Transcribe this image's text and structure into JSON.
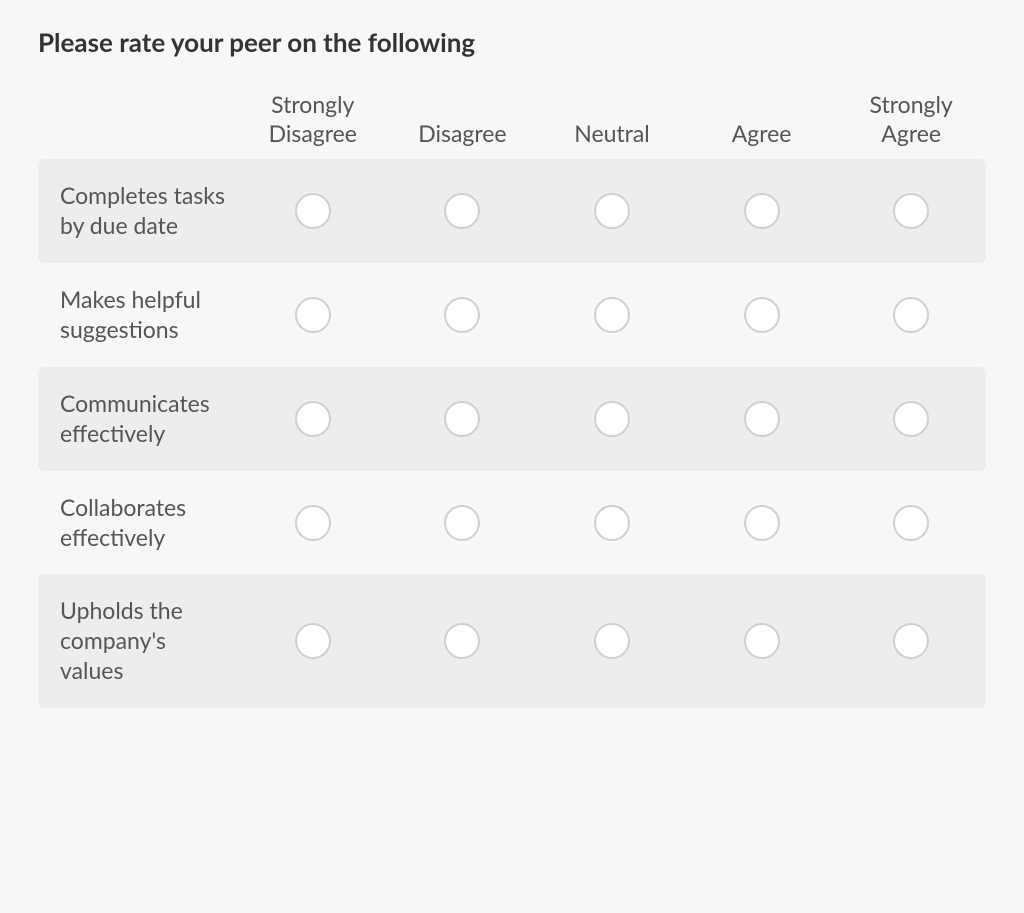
{
  "question_title": "Please rate your peer on the following",
  "columns": [
    "Strongly Disagree",
    "Disagree",
    "Neutral",
    "Agree",
    "Strongly Agree"
  ],
  "rows": [
    "Completes tasks by due date",
    "Makes helpful suggestions",
    "Communicates effectively",
    "Collaborates effectively",
    "Upholds the company's values"
  ]
}
